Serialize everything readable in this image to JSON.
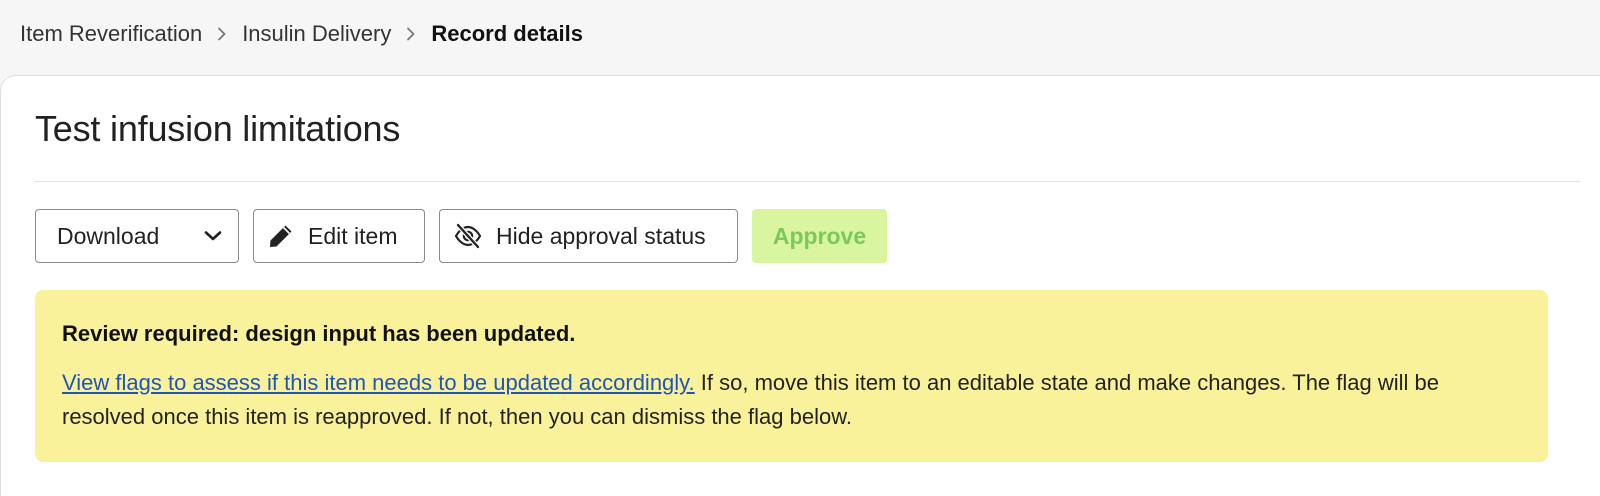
{
  "breadcrumb": {
    "items": [
      {
        "label": "Item Reverification"
      },
      {
        "label": "Insulin Delivery"
      },
      {
        "label": "Record details"
      }
    ],
    "separator_icon": "chevron-right-icon"
  },
  "page": {
    "title": "Test infusion limitations"
  },
  "toolbar": {
    "download_label": "Download",
    "download_icon": "chevron-down-icon",
    "edit_label": "Edit item",
    "edit_icon": "pencil-icon",
    "hide_label": "Hide approval status",
    "hide_icon": "eye-slash-icon",
    "approve_label": "Approve"
  },
  "alert": {
    "title": "Review required: design input has been updated.",
    "link_text": "View flags to assess if this item needs to be updated accordingly.",
    "body_text": " If so, move this item to an editable state and make changes. The flag will be resolved once this item is reapproved. If not, then you can dismiss the flag below."
  },
  "colors": {
    "approve_bg": "#d9f5a0",
    "approve_text": "#7cc85a",
    "alert_bg": "#faf29b",
    "link": "#1f55b8"
  }
}
